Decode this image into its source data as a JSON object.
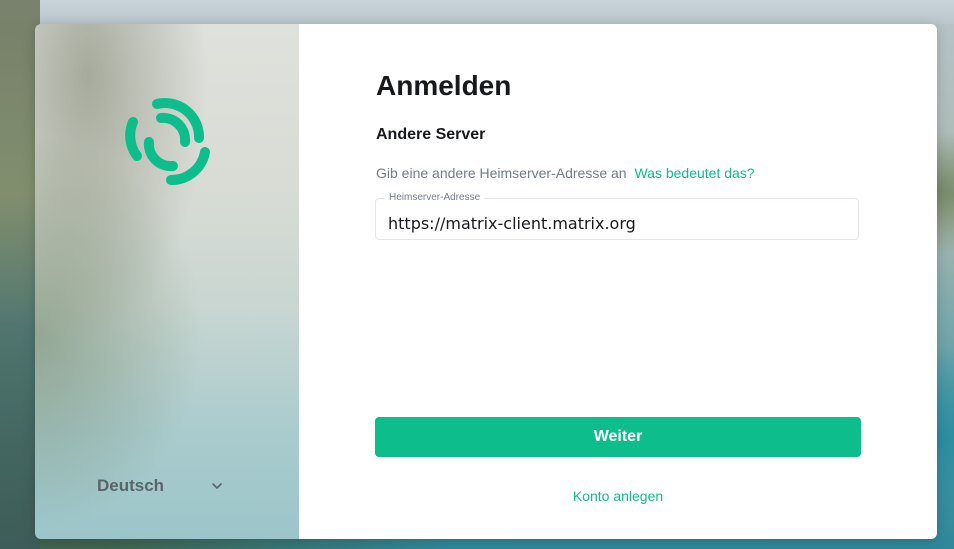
{
  "auth": {
    "title": "Anmelden",
    "server_section": {
      "heading": "Andere Server",
      "description": "Gib eine andere Heimserver-Adresse an",
      "help_link": "Was bedeutet das?"
    },
    "homeserver_field": {
      "label": "Heimserver-Adresse",
      "value": "https://matrix-client.matrix.org"
    },
    "continue_button": "Weiter",
    "create_account_link": "Konto anlegen"
  },
  "sidebar": {
    "logo_icon": "element-logo-icon",
    "language": {
      "selected": "Deutsch",
      "icon": "chevron-down-icon"
    }
  },
  "colors": {
    "accent": "#0dbd8b",
    "text_primary": "#17191c",
    "text_secondary": "#737d8c"
  }
}
